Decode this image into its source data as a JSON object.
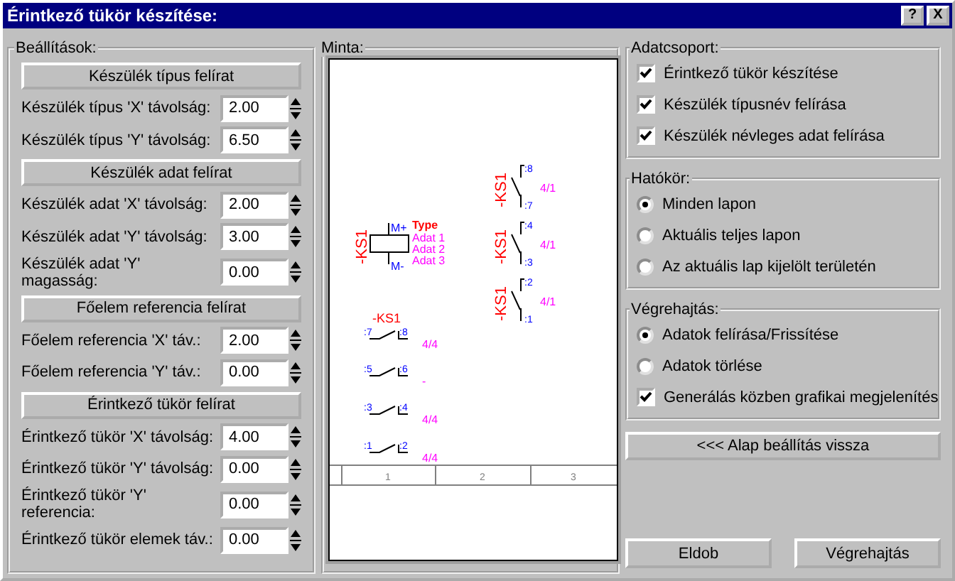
{
  "window": {
    "title": "Érintkező tükör készítése:",
    "help": "?",
    "close": "X"
  },
  "settings": {
    "title": "Beállítások:",
    "sections": [
      {
        "heading": "Készülék típus felírat",
        "fields": [
          {
            "label": "Készülék típus 'X' távolság:",
            "value": "2.00"
          },
          {
            "label": "Készülék típus 'Y' távolság:",
            "value": "6.50"
          }
        ]
      },
      {
        "heading": "Készülék adat felírat",
        "fields": [
          {
            "label": "Készülék adat 'X' távolság:",
            "value": "2.00"
          },
          {
            "label": "Készülék adat 'Y' távolság:",
            "value": "3.00"
          },
          {
            "label": "Készülék adat 'Y' magasság:",
            "value": "0.00"
          }
        ]
      },
      {
        "heading": "Főelem referencia felírat",
        "fields": [
          {
            "label": "Főelem referencia 'X' táv.:",
            "value": "2.00"
          },
          {
            "label": "Főelem referencia 'Y' táv.:",
            "value": "0.00"
          }
        ]
      },
      {
        "heading": "Érintkező tükör felírat",
        "fields": [
          {
            "label": "Érintkező tükör 'X' távolság:",
            "value": "4.00"
          },
          {
            "label": "Érintkező tükör 'Y' távolság:",
            "value": "0.00"
          },
          {
            "label": "Érintkező tükör 'Y' referencia:",
            "value": "0.00"
          },
          {
            "label": "Érintkező tükör elemek táv.:",
            "value": "0.00"
          }
        ]
      }
    ]
  },
  "preview": {
    "title": "Minta:",
    "coil": {
      "tag": "-KS1",
      "plus": "M+",
      "minus": "M-",
      "type": "Type",
      "data": [
        "Adat 1",
        "Adat 2",
        "Adat 3"
      ]
    },
    "mirror_contacts": [
      {
        "tag": "-KS1",
        "top": ":8",
        "bottom": ":7",
        "ref": "4/1"
      },
      {
        "tag": "-KS1",
        "top": ":4",
        "bottom": ":3",
        "ref": "4/1"
      },
      {
        "tag": "-KS1",
        "top": ":2",
        "bottom": ":1",
        "ref": "4/1"
      }
    ],
    "contact_tag": "-KS1",
    "contacts": [
      {
        "left": ":7",
        "right": ":8",
        "ref": "4/4"
      },
      {
        "left": ":5",
        "right": ":6",
        "ref": "-"
      },
      {
        "left": ":3",
        "right": ":4",
        "ref": "4/4"
      },
      {
        "left": ":1",
        "right": ":2",
        "ref": "4/4"
      }
    ],
    "columns": [
      "1",
      "2",
      "3"
    ]
  },
  "data_group": {
    "title": "Adatcsoport:",
    "items": [
      {
        "label": "Érintkező tükör készítése",
        "checked": true
      },
      {
        "label": "Készülék típusnév felírása",
        "checked": true
      },
      {
        "label": "Készülék névleges adat felírása",
        "checked": true
      }
    ]
  },
  "scope": {
    "title": "Hatókör:",
    "options": [
      {
        "label": "Minden lapon",
        "selected": true
      },
      {
        "label": "Aktuális teljes lapon",
        "selected": false
      },
      {
        "label": "Az aktuális lap kijelölt területén",
        "selected": false
      }
    ]
  },
  "execution": {
    "title": "Végrehajtás:",
    "items": [
      {
        "kind": "radio",
        "label": "Adatok felírása/Frissítése",
        "selected": true
      },
      {
        "kind": "radio",
        "label": "Adatok törlése",
        "selected": false
      },
      {
        "kind": "checkbox",
        "label": "Generálás közben grafikai megjelenítés",
        "checked": true
      }
    ]
  },
  "reset_button": "<<< Alap beállítás vissza",
  "footer_buttons": [
    "Eldob",
    "Végrehajtás"
  ]
}
